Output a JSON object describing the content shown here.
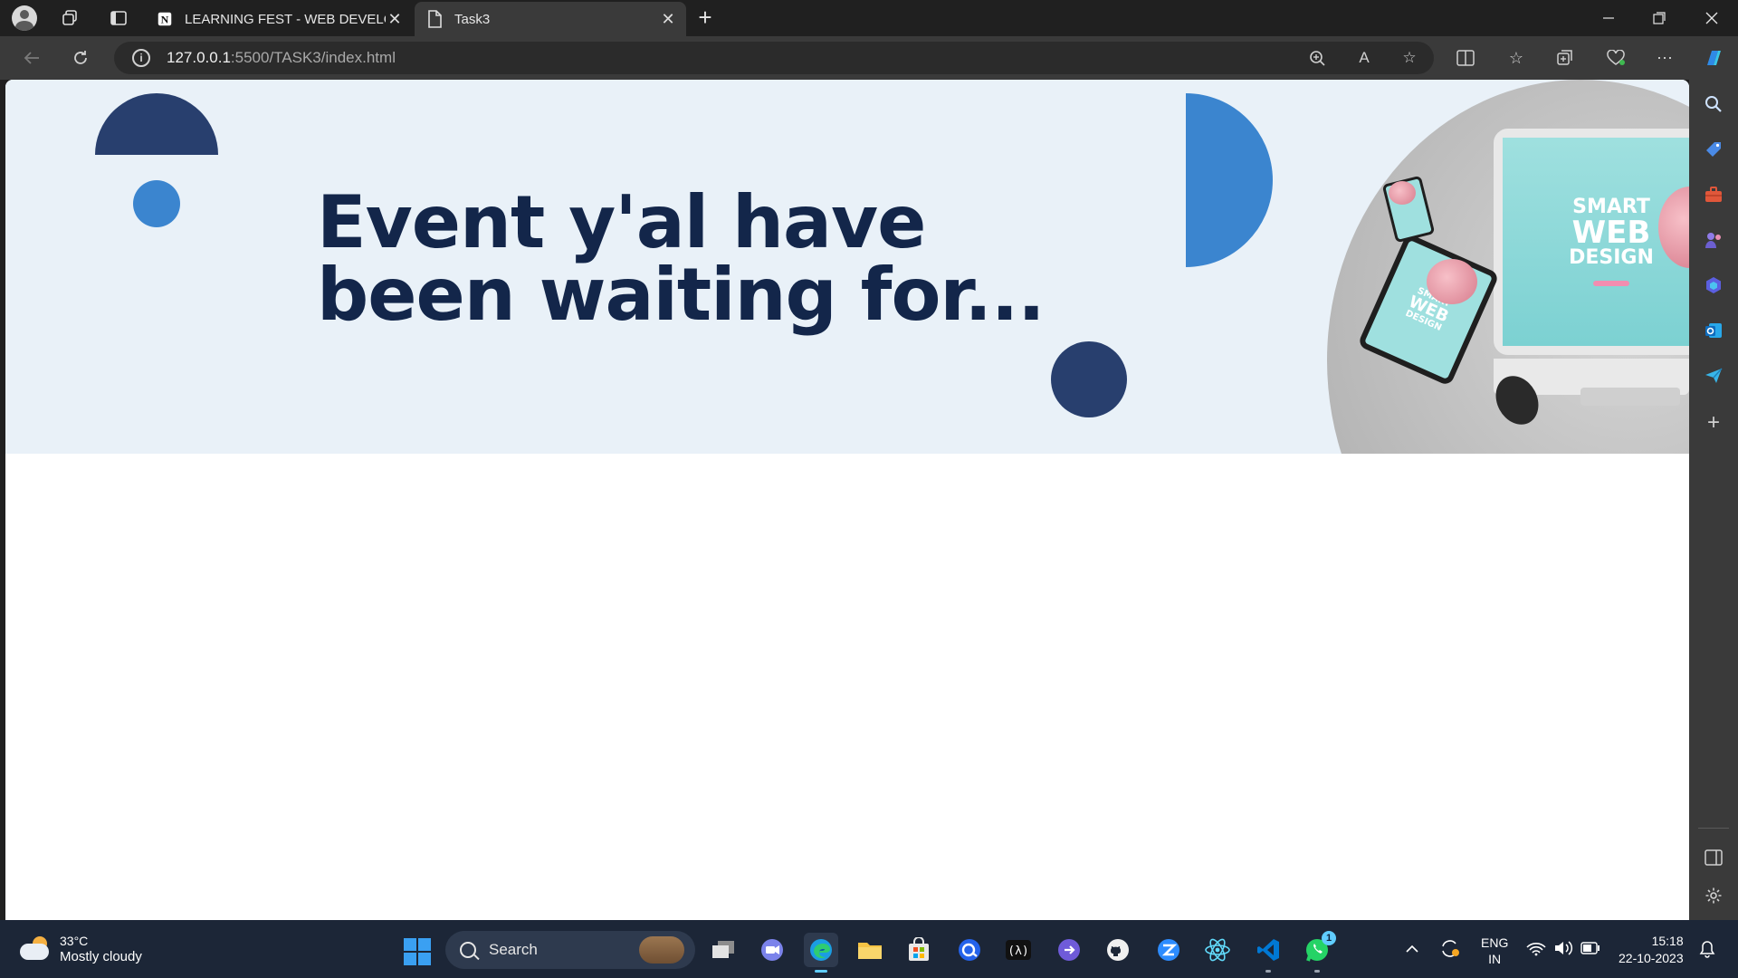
{
  "browser": {
    "tabs": [
      {
        "title": "LEARNING FEST - WEB DEVELOPI",
        "active": false
      },
      {
        "title": "Task3",
        "active": true
      }
    ],
    "address": {
      "host": "127.0.0.1",
      "rest": ":5500/TASK3/index.html"
    }
  },
  "page": {
    "headline_line1": "Event y'al have",
    "headline_line2": "been waiting for...",
    "hero_image": {
      "line1": "SMART",
      "line2": "WEB",
      "line3": "DESIGN"
    },
    "colors": {
      "navy": "#283f6e",
      "blue": "#3b85cf",
      "hero_bg": "#e9f1f8",
      "headline": "#13264a"
    }
  },
  "taskbar": {
    "weather": {
      "temp": "33°C",
      "condition": "Mostly cloudy"
    },
    "search_label": "Search",
    "language": {
      "line1": "ENG",
      "line2": "IN"
    },
    "clock": {
      "time": "15:18",
      "date": "22-10-2023"
    },
    "whatsapp_badge": "1"
  }
}
